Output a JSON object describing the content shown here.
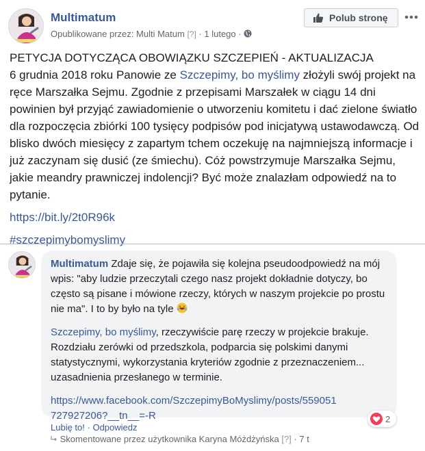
{
  "post": {
    "page_name": "Multimatum",
    "published_by_prefix": "Opublikowane przez: ",
    "published_by_name": "Multi Matum",
    "help_marker": "[?]",
    "separator": "·",
    "date": "1 lutego",
    "privacy_icon": "globe-icon",
    "like_page_button": "Polub stronę",
    "like_icon": "thumbs-up-icon",
    "more_icon": "more-horizontal-icon",
    "title": "PETYCJA DOTYCZĄCA OBOWIĄZKU SZCZEPIEŃ - AKTUALIZACJA",
    "body_before_mention": "6 grudnia 2018 roku Panowie ze ",
    "mention": "Szczepimy, bo myślimy",
    "body_after_mention": " złożyli swój projekt na ręce Marszałka Sejmu. Zgodnie z przepisami Marszałek w ciągu 14 dni powinien był przyjąć zawiadomienie o utworzeniu komitetu i dać zielone światło dla rozpoczęcia zbiórki 100 tysięcy podpisów pod inicjatywą ustawodawczą. Od blisko dwóch miesięcy z zapartym tchem oczekuję na najmniejszą informacje i już zaczynam się dusić (ze śmiechu). Cóż powstrzymuje Marszałka Sejmu, jakie meandry prawniczej indolencji? Być może znalazłam odpowiedź na to pytanie.",
    "short_url": "https://bit.ly/2t0R96k",
    "hashtag": "#szczepimybomyslimy"
  },
  "comment": {
    "author": "Multimatum",
    "text_part1": "Zdaje się, że pojawiła się kolejna pseudoodpowiedź na mój wpis: \"aby ludzie przeczytali czego nasz projekt dokładnie dotyczy, bo często są pisane i mówione rzeczy, których w naszym projekcie po prostu nie ma\". I to by było na tyle",
    "emoji_icon": "rolling-on-floor-laughing-emoji",
    "mention": "Szczepimy, bo myślimy",
    "text_part2": ", rzeczywiście parę rzeczy w projekcie brakuje. Rozdziału zerówki od przedszkola, podparcia się polskimi danymi statystycznymi, wykorzystania kryteriów zgodnie z przeznaczeniem... uzasadnienia przesłanego w terminie.",
    "url": "https://www.facebook.com/SzczepimyBoMyslimy/posts/559051727927206?__tn__=-R",
    "reaction_icon": "heart-reaction-icon",
    "reaction_count": "2",
    "like_action": "Lubię to!",
    "action_separator": "·",
    "reply_action": "Odpowiedz",
    "reply_arrow_icon": "reply-arrow-icon",
    "commented_by": "Skomentowane przez użytkownika Karyna Móżdżyńska",
    "help_marker": "[?]",
    "time_separator": "·",
    "time": "7 t"
  },
  "colors": {
    "link": "#385898",
    "text": "#1c1e21",
    "meta": "#606770",
    "bubble": "#f2f3f5",
    "heart": "#f33e58"
  }
}
